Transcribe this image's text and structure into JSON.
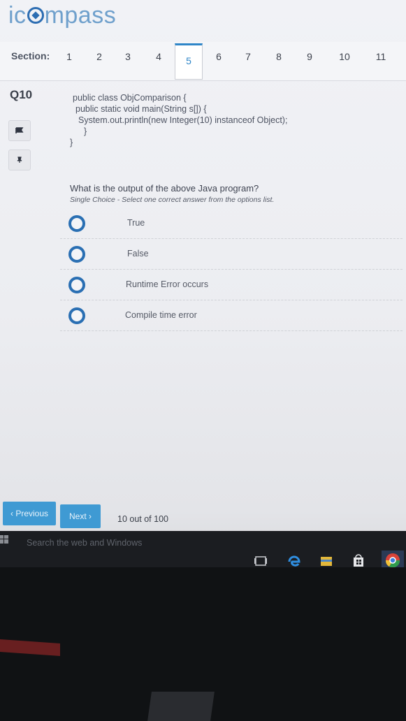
{
  "logo": {
    "text_left": "ic",
    "text_right": "mpass"
  },
  "section_bar": {
    "label": "Section:",
    "sections": [
      "1",
      "2",
      "3",
      "4",
      "5",
      "6",
      "7",
      "8",
      "9",
      "10",
      "11"
    ],
    "active": "5"
  },
  "question": {
    "number": "Q10",
    "code_lines": [
      "public class ObjComparison {",
      "public static void main(String s[]) {",
      "System.out.println(new Integer(10) instanceof Object);",
      "}",
      "}"
    ],
    "prompt": "What is the output of the above Java program?",
    "hint": "Single Choice - Select one correct answer from the options list.",
    "options": [
      "True",
      "False",
      "Runtime Error occurs",
      "Compile time error"
    ]
  },
  "navigation": {
    "previous_label": "‹ Previous",
    "next_label": "Next ›",
    "progress_text": "10 out of 100"
  },
  "taskbar": {
    "search_placeholder": "Search the web and Windows",
    "icons": [
      "task-view-icon",
      "edge-icon",
      "file-explorer-icon",
      "store-icon",
      "chrome-icon"
    ]
  },
  "colors": {
    "accent": "#2f86c8",
    "radio": "#2a6fb3",
    "button": "#3f9ad3",
    "taskbar": "#1b1d21"
  }
}
